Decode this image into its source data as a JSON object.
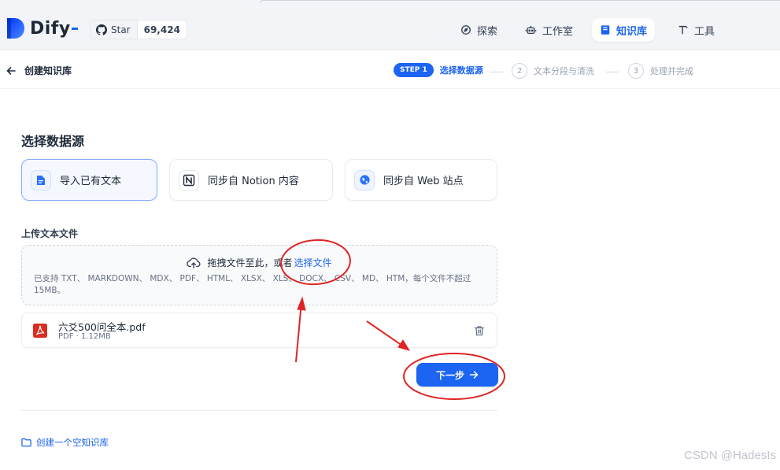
{
  "header": {
    "brand": "Dify",
    "github": {
      "label": "Star",
      "count": "69,424"
    },
    "nav": [
      {
        "label": "探索",
        "icon": "compass-icon"
      },
      {
        "label": "工作室",
        "icon": "robot-icon"
      },
      {
        "label": "知识库",
        "icon": "book-icon",
        "active": true
      },
      {
        "label": "工具",
        "icon": "hammer-icon"
      }
    ]
  },
  "subheader": {
    "back_label": "创建知识库",
    "steps": [
      {
        "badge": "STEP 1",
        "label": "选择数据源",
        "active": true
      },
      {
        "num": "2",
        "label": "文本分段与清洗"
      },
      {
        "num": "3",
        "label": "处理并完成"
      }
    ]
  },
  "main": {
    "title": "选择数据源",
    "sources": [
      {
        "label": "导入已有文本",
        "icon": "document-icon",
        "active": true
      },
      {
        "label": "同步自 Notion 内容",
        "icon": "notion-icon"
      },
      {
        "label": "同步自 Web 站点",
        "icon": "web-icon"
      }
    ],
    "upload": {
      "label": "上传文本文件",
      "drop_text": "拖拽文件至此，或者",
      "browse_link": "选择文件",
      "hint": "已支持 TXT、 MARKDOWN、 MDX、 PDF、 HTML、 XLSX、 XLS、 DOCX、 CSV、 MD、 HTM，每个文件不超过 15MB。"
    },
    "file": {
      "name": "六爻500问全本.pdf",
      "meta": "PDF · 1.12MB"
    },
    "next_button": "下一步",
    "empty_kb_link": "创建一个空知识库"
  },
  "watermark": "CSDN @HadesIs",
  "colors": {
    "accent": "#1c64f2",
    "annotation": "#e02424",
    "pdf": "#d92d20"
  }
}
